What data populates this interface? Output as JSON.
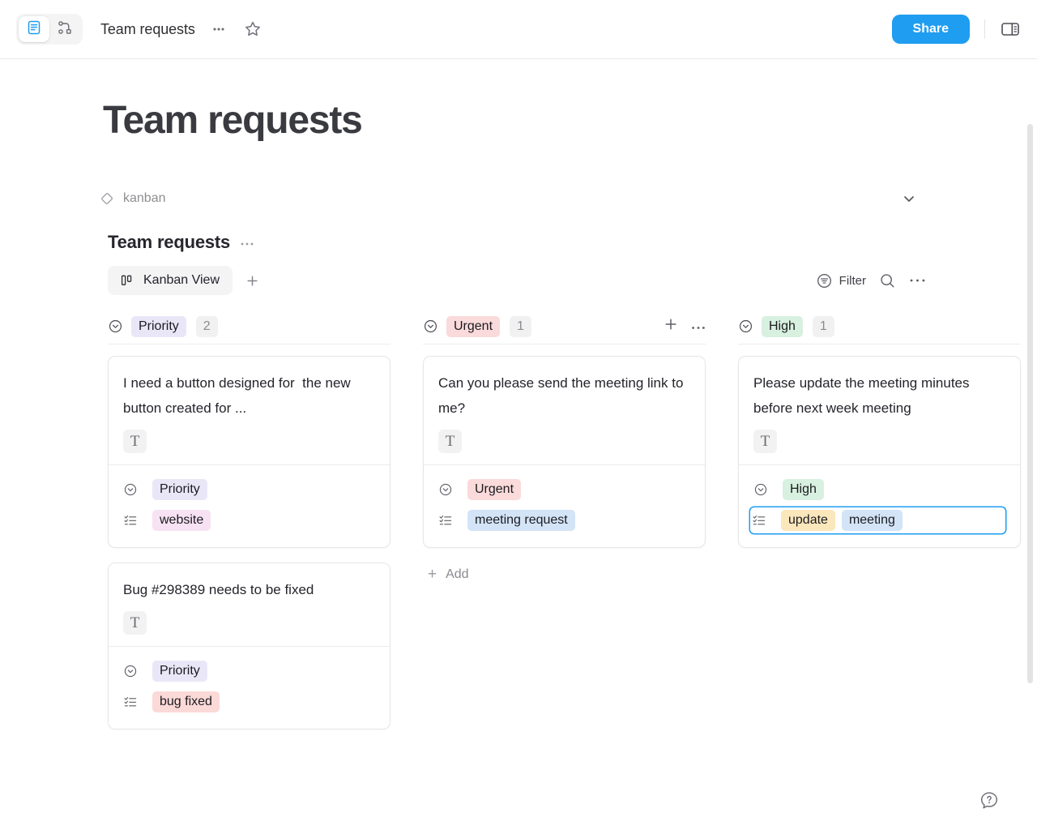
{
  "topbar": {
    "mode_page_icon": "doc-mode-icon",
    "mode_edgeless_icon": "edgeless-mode-icon",
    "doc_title": "Team requests",
    "more_icon": "more-horizontal-icon",
    "favorite_icon": "star-icon",
    "share_label": "Share",
    "sidebar_toggle_icon": "right-sidebar-icon"
  },
  "page": {
    "title": "Team requests",
    "tag": {
      "icon": "tag-icon",
      "label": "kanban",
      "collapse_icon": "chevron-down-icon"
    },
    "database": {
      "name": "Team requests",
      "more_icon": "more-horizontal-icon",
      "view_tab": {
        "icon": "kanban-view-icon",
        "label": "Kanban View"
      },
      "add_view_icon": "plus-icon",
      "tools": {
        "filter_label": "Filter",
        "filter_icon": "filter-icon",
        "search_icon": "search-icon",
        "more_icon": "more-horizontal-icon"
      }
    }
  },
  "colors": {
    "accent": "#1e9df1",
    "chip_purple_bg": "#e9e7f7",
    "chip_pink_bg": "#fadada",
    "chip_green_bg": "#d8f0df",
    "chip_magenta_bg": "#f7e2f3",
    "chip_blue_bg": "#d3e4f7",
    "chip_yellow_bg": "#fbe7bc",
    "chip_red_bg": "#fbd9d7"
  },
  "board": {
    "groups": [
      {
        "icon": "select-property-icon",
        "chip": {
          "label": "Priority",
          "bg": "#e9e7f7"
        },
        "count": "2",
        "actions": [],
        "cards": [
          {
            "title": "I need a button designed for  the new button created for ...",
            "type_badge": "T",
            "props": [
              {
                "icon": "select-property-icon",
                "focused": false,
                "tags": [
                  {
                    "label": "Priority",
                    "bg": "#e9e7f7"
                  }
                ]
              },
              {
                "icon": "multi-select-property-icon",
                "focused": false,
                "tags": [
                  {
                    "label": "website",
                    "bg": "#f7e2f3"
                  }
                ]
              }
            ]
          },
          {
            "title": "Bug #298389 needs to be fixed",
            "type_badge": "T",
            "props": [
              {
                "icon": "select-property-icon",
                "focused": false,
                "tags": [
                  {
                    "label": "Priority",
                    "bg": "#e9e7f7"
                  }
                ]
              },
              {
                "icon": "multi-select-property-icon",
                "focused": false,
                "tags": [
                  {
                    "label": "bug fixed",
                    "bg": "#fbd9d7"
                  }
                ]
              }
            ]
          }
        ],
        "add_label": null
      },
      {
        "icon": "select-property-icon",
        "chip": {
          "label": "Urgent",
          "bg": "#fadada"
        },
        "count": "1",
        "actions": [
          "plus-icon",
          "more-horizontal-icon"
        ],
        "cards": [
          {
            "title": "Can you please send the meeting link to me?",
            "type_badge": "T",
            "props": [
              {
                "icon": "select-property-icon",
                "focused": false,
                "tags": [
                  {
                    "label": "Urgent",
                    "bg": "#fadada"
                  }
                ]
              },
              {
                "icon": "multi-select-property-icon",
                "focused": false,
                "tags": [
                  {
                    "label": "meeting request",
                    "bg": "#d3e4f7"
                  }
                ]
              }
            ]
          }
        ],
        "add_label": "Add"
      },
      {
        "icon": "select-property-icon",
        "chip": {
          "label": "High",
          "bg": "#d8f0df"
        },
        "count": "1",
        "actions": [],
        "cards": [
          {
            "title": "Please update the meeting minutes before next week meeting",
            "type_badge": "T",
            "props": [
              {
                "icon": "select-property-icon",
                "focused": false,
                "tags": [
                  {
                    "label": "High",
                    "bg": "#d8f0df"
                  }
                ]
              },
              {
                "icon": "multi-select-property-icon",
                "focused": true,
                "tags": [
                  {
                    "label": "update",
                    "bg": "#fbe7bc"
                  },
                  {
                    "label": "meeting",
                    "bg": "#d3e4f7"
                  }
                ]
              }
            ]
          }
        ],
        "add_label": null
      }
    ]
  },
  "help": {
    "icon": "help-question-icon"
  }
}
